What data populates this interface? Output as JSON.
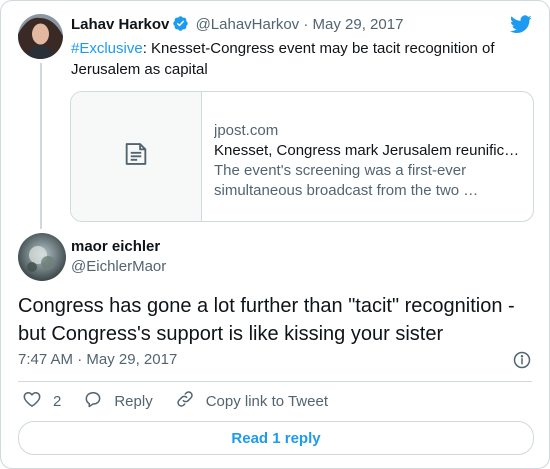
{
  "parent_tweet": {
    "name": "Lahav Harkov",
    "handle": "@LahavHarkov",
    "separator": "·",
    "date": "May 29, 2017",
    "hashtag": "#Exclusive",
    "text": ": Knesset-Congress event may be tacit recognition of Jerusalem as capital",
    "link_card": {
      "domain": "jpost.com",
      "title": "Knesset, Congress mark Jerusalem reunific…",
      "description_line1": "The event's screening was a first-ever",
      "description_line2": "simultaneous broadcast from the two …",
      "thumbnail_icon": "document-icon"
    }
  },
  "reply_tweet": {
    "name": "maor eichler",
    "handle": "@EichlerMaor",
    "text": "Congress has gone a lot further than \"tacit\" recognition - but Congress's support is like kissing your sister",
    "time": "7:47 AM",
    "separator": "·",
    "date": "May 29, 2017"
  },
  "actions": {
    "like_count": "2",
    "reply_label": "Reply",
    "copy_link_label": "Copy link to Tweet"
  },
  "read_replies_label": "Read 1 reply",
  "colors": {
    "accent": "#1d9bf0",
    "muted": "#536471",
    "border": "#cfd9de"
  }
}
